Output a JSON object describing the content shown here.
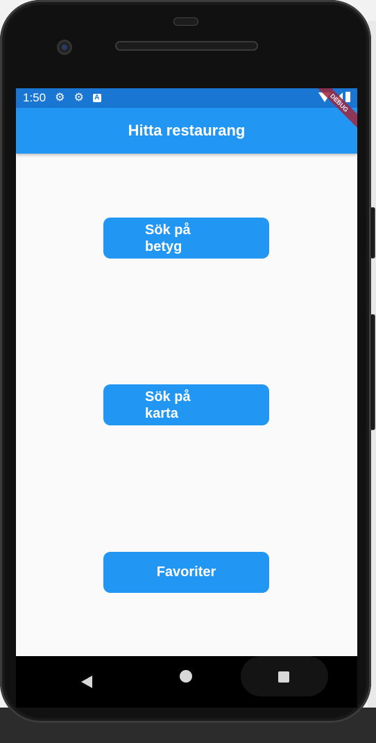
{
  "status_bar": {
    "time": "1:50",
    "icons": [
      "gear-icon",
      "gear-icon",
      "a-icon",
      "wifi-icon",
      "signal-icon",
      "battery-icon"
    ]
  },
  "app_bar": {
    "title": "Hitta restaurang",
    "debug_label": "DEBUG"
  },
  "buttons": {
    "rating_label": "Sök på betyg",
    "map_label": "Sök på karta",
    "favorites_label": "Favoriter"
  },
  "colors": {
    "status_bar": "#1976d2",
    "primary": "#2196f3",
    "background": "#fafafa",
    "debug_banner": "#a0263c"
  },
  "nav_icons": [
    "back-icon",
    "home-icon",
    "recents-icon"
  ]
}
